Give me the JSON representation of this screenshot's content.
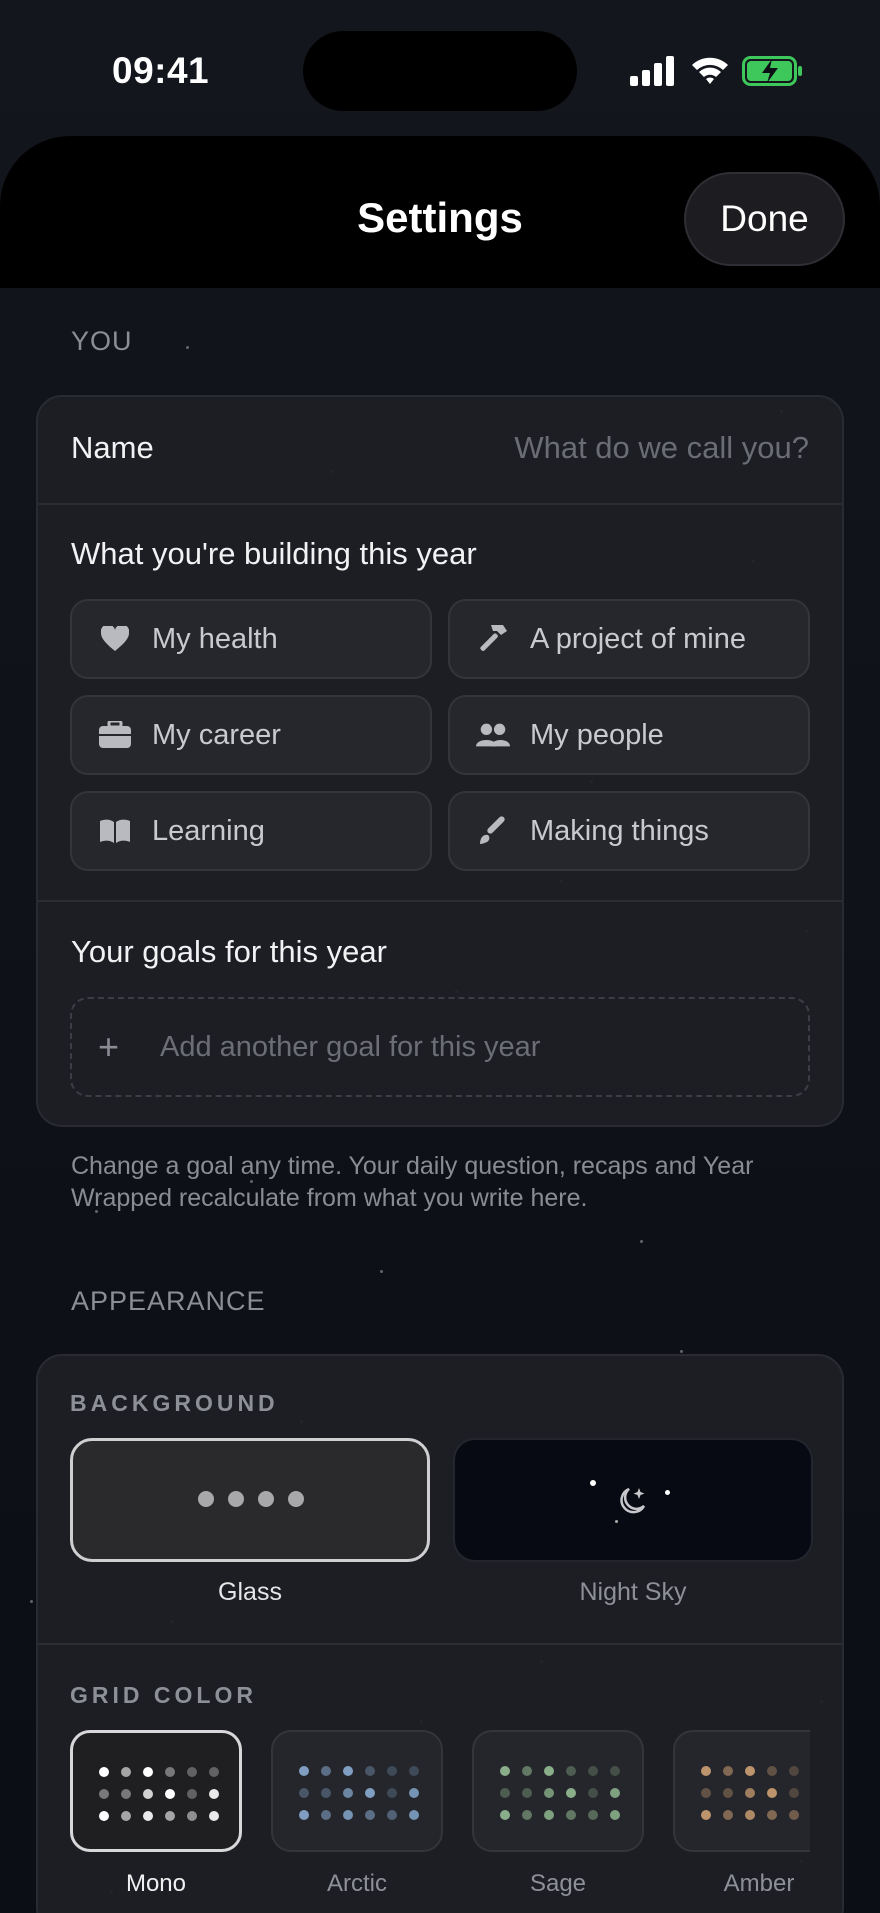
{
  "status_bar": {
    "time": "09:41"
  },
  "header": {
    "title": "Settings",
    "done_label": "Done"
  },
  "you_section": {
    "label": "YOU",
    "name_label": "Name",
    "name_placeholder": "What do we call you?",
    "building_label": "What you're building this year",
    "chips": [
      {
        "label": "My health",
        "icon": "heart-icon"
      },
      {
        "label": "A project of mine",
        "icon": "hammer-icon"
      },
      {
        "label": "My career",
        "icon": "briefcase-icon"
      },
      {
        "label": "My people",
        "icon": "people-icon"
      },
      {
        "label": "Learning",
        "icon": "book-icon"
      },
      {
        "label": "Making things",
        "icon": "paintbrush-icon"
      }
    ],
    "goals_label": "Your goals for this year",
    "add_goal_placeholder": "Add another goal for this year",
    "footnote": "Change a goal any time. Your daily question, recaps and Year Wrapped recalculate from what you write here."
  },
  "appearance_section": {
    "label": "APPEARANCE",
    "background_label": "BACKGROUND",
    "backgrounds": [
      {
        "label": "Glass",
        "selected": true
      },
      {
        "label": "Night Sky",
        "selected": false
      }
    ],
    "grid_color_label": "GRID COLOR",
    "grid_colors": [
      {
        "label": "Mono",
        "color": "#ffffff",
        "selected": true
      },
      {
        "label": "Arctic",
        "color": "#8fb4dc",
        "selected": false
      },
      {
        "label": "Sage",
        "color": "#9cc79a",
        "selected": false
      },
      {
        "label": "Amber",
        "color": "#d8a878",
        "selected": false
      }
    ]
  },
  "colors": {
    "background": "#0d0f16",
    "card": "#1e1f25",
    "text_primary": "#f2f2f4",
    "text_secondary": "#8c8e96",
    "battery_fill": "#3ec75a"
  }
}
